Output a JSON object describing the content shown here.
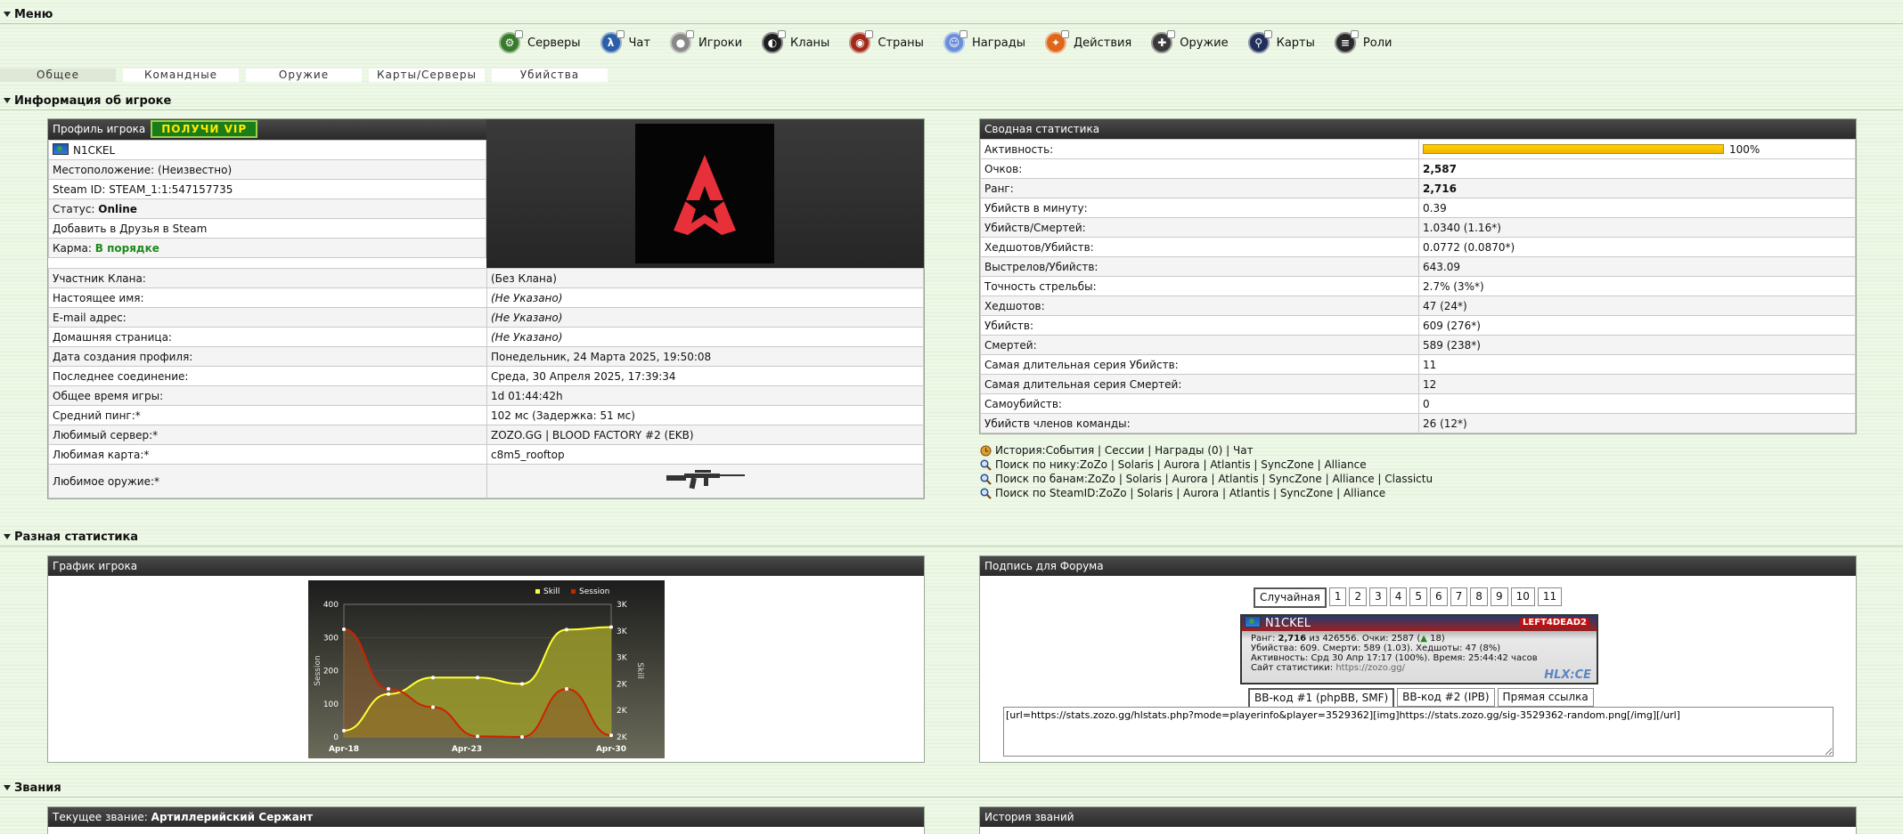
{
  "menu_heading": "Меню",
  "nav": [
    {
      "label": "Серверы",
      "icon": "servers-icon",
      "color": "#3a7a2c"
    },
    {
      "label": "Чат",
      "icon": "chat-icon",
      "color": "#2c5fa8"
    },
    {
      "label": "Игроки",
      "icon": "players-icon",
      "color": "#888888"
    },
    {
      "label": "Кланы",
      "icon": "clans-icon",
      "color": "#1f1f1f"
    },
    {
      "label": "Страны",
      "icon": "countries-icon",
      "color": "#a12a1a"
    },
    {
      "label": "Награды",
      "icon": "awards-icon",
      "color": "#6a8ed8"
    },
    {
      "label": "Действия",
      "icon": "actions-icon",
      "color": "#e0661a"
    },
    {
      "label": "Оружие",
      "icon": "weapons-icon",
      "color": "#3a3a3a"
    },
    {
      "label": "Карты",
      "icon": "maps-icon",
      "color": "#20305a"
    },
    {
      "label": "Роли",
      "icon": "roles-icon",
      "color": "#2a2a2a"
    }
  ],
  "tabs": [
    "Общее",
    "Командные",
    "Оружие",
    "Карты/Серверы",
    "Убийства"
  ],
  "player_info_heading": "Информация об игроке",
  "profile": {
    "header": "Профиль игрока",
    "vip": "ПОЛУЧИ VIP",
    "name": "N1CKEL",
    "location": "Местоположение: (Неизвестно)",
    "steam_id": "Steam ID: STEAM_1:1:547157735",
    "status_label": "Статус:",
    "status_value": "Online",
    "add_friend": "Добавить в Друзья в Steam",
    "karma_label": "Карма:",
    "karma_value": "В порядке"
  },
  "details": [
    {
      "label": "Участник Клана:",
      "value": "(Без Клана)"
    },
    {
      "label": "Настоящее имя:",
      "value": "(Не Указано)",
      "italic": true
    },
    {
      "label": "E-mail адрес:",
      "value": "(Не Указано)",
      "italic": true
    },
    {
      "label": "Домашняя страница:",
      "value": "(Не Указано)",
      "italic": true
    },
    {
      "label": "Дата создания профиля:",
      "value": "Понедельник, 24 Марта 2025, 19:50:08"
    },
    {
      "label": "Последнее соединение:",
      "value": "Среда, 30 Апреля 2025, 17:39:34"
    },
    {
      "label": "Общее время игры:",
      "value": "1d 01:44:42h"
    },
    {
      "label": "Средний пинг:*",
      "value": "102 мс (Задержка: 51 мс)"
    },
    {
      "label": "Любимый сервер:*",
      "value": "ZOZO.GG | BLOOD FACTORY #2 (EKB)"
    },
    {
      "label": "Любимая карта:*",
      "value": "c8m5_rooftop"
    }
  ],
  "fav_weapon_label": "Любимое оружие:*",
  "summary": {
    "header": "Сводная статистика",
    "activity_label": "Активность:",
    "activity_value": "100%",
    "activity_fraction": 1.0,
    "rows": [
      {
        "label": "Очков:",
        "value": "2,587",
        "bold": true
      },
      {
        "label": "Ранг:",
        "value": "2,716",
        "bold": true
      },
      {
        "label": "Убийств в минуту:",
        "value": "0.39"
      },
      {
        "label": "Убийств/Смертей:",
        "value": "1.0340 (1.16*)"
      },
      {
        "label": "Хедшотов/Убийств:",
        "value": "0.0772 (0.0870*)"
      },
      {
        "label": "Выстрелов/Убийств:",
        "value": "643.09"
      },
      {
        "label": "Точность стрельбы:",
        "value": "2.7% (3%*)"
      },
      {
        "label": "Хедшотов:",
        "value": "47 (24*)"
      },
      {
        "label": "Убийств:",
        "value": "609 (276*)"
      },
      {
        "label": "Смертей:",
        "value": "589 (238*)"
      },
      {
        "label": "Самая длительная серия Убийств:",
        "value": "11"
      },
      {
        "label": "Самая длительная серия Смертей:",
        "value": "12"
      },
      {
        "label": "Самоубийств:",
        "value": "0"
      },
      {
        "label": "Убийств членов команды:",
        "value": "26 (12*)"
      }
    ]
  },
  "links": [
    {
      "prefix": "История:",
      "items": [
        "События",
        "Сессии",
        "Награды (0)",
        "Чат"
      ]
    },
    {
      "prefix": "Поиск по нику:",
      "items": [
        "ZoZo",
        "Solaris",
        "Aurora",
        "Atlantis",
        "SyncZone",
        "Alliance"
      ]
    },
    {
      "prefix": "Поиск по банам:",
      "items": [
        "ZoZo",
        "Solaris",
        "Aurora",
        "Atlantis",
        "SyncZone",
        "Alliance",
        "Classictu"
      ]
    },
    {
      "prefix": "Поиск по SteamID:",
      "items": [
        "ZoZo",
        "Solaris",
        "Aurora",
        "Atlantis",
        "SyncZone",
        "Alliance"
      ]
    }
  ],
  "misc_heading": "Разная статистика",
  "graph_panel": {
    "header": "График игрока"
  },
  "chart_data": {
    "type": "line",
    "x": [
      "Apr-18",
      "Apr-19",
      "Apr-21",
      "Apr-22",
      "Apr-23",
      "Apr-24",
      "Apr-27",
      "Apr-28",
      "Apr-30"
    ],
    "x_tick_labels": [
      "Apr-18",
      "Apr-23",
      "Apr-30"
    ],
    "series": [
      {
        "name": "Skill",
        "color": "#ffff33",
        "values": [
          2000,
          2290,
          2420,
          2420,
          2370,
          2800,
          2820
        ]
      },
      {
        "name": "Session",
        "color": "#cc2200",
        "values": [
          325,
          145,
          90,
          2,
          0,
          145,
          5
        ]
      }
    ],
    "left_axis": {
      "label": "Session",
      "ticks": [
        "0",
        "100",
        "200",
        "300",
        "400"
      ],
      "range": [
        0,
        400
      ]
    },
    "right_axis": {
      "label": "Skill",
      "ticks": [
        "2K",
        "2K",
        "2K",
        "3K",
        "3K",
        "3K"
      ]
    },
    "legend_position": "top-right"
  },
  "signature": {
    "header": "Подпись для Форума",
    "random_label": "Случайная",
    "pages": [
      "1",
      "2",
      "3",
      "4",
      "5",
      "6",
      "7",
      "8",
      "9",
      "10",
      "11"
    ],
    "card": {
      "name": "N1CKEL",
      "rank_line_prefix": "Ранг: ",
      "rank_value": "2,716",
      "rank_line_suffix": " из 426556. Очки: 2587 (",
      "rank_trend": "18",
      "kills_line": "Убийства: 609. Смерти: 589 (1.03). Хедшоты: 47 (8%)",
      "activity_line": "Активность: Срд 30 Апр 17:17 (100%). Время: 25:44:42 часов",
      "site_label": "Сайт статистики:",
      "site_url": "https://zozo.gg/",
      "logo_text": "HLX:CE",
      "game_label": "LEFT4DEAD2"
    },
    "code_tabs": [
      "BB-код #1 (phpBB, SMF)",
      "BB-код #2 (IPB)",
      "Прямая ссылка"
    ],
    "code": "[url=https://stats.zozo.gg/hlstats.php?mode=playerinfo&player=3529362][img]https://stats.zozo.gg/sig-3529362-random.png[/img][/url]"
  },
  "ranks_heading": "Звания",
  "current_rank_label": "Текущее звание:",
  "current_rank_value": "Артиллерийский Сержант",
  "rank_history_header": "История званий"
}
